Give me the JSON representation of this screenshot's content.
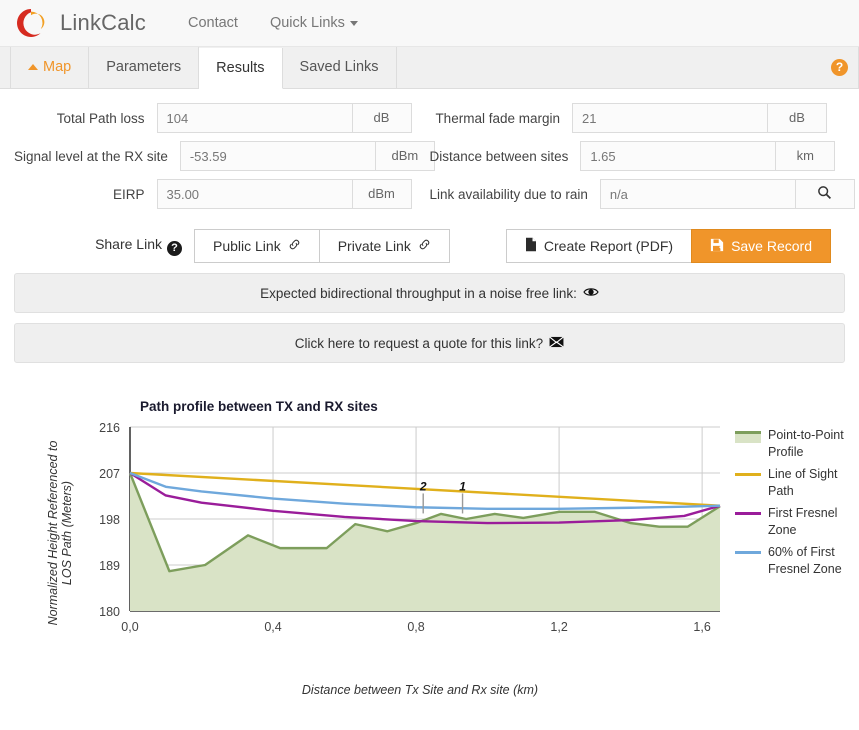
{
  "header": {
    "brand": "LinkCalc",
    "logo_colors": {
      "red": "#d62b20",
      "orange": "#f2a024"
    },
    "nav": [
      {
        "label": "Contact",
        "caret": false
      },
      {
        "label": "Quick Links",
        "caret": true
      }
    ]
  },
  "tabs": {
    "items": [
      {
        "label": "Map",
        "accent": true,
        "icon": "chevron-up-icon",
        "active": false
      },
      {
        "label": "Parameters",
        "accent": false,
        "active": false
      },
      {
        "label": "Results",
        "accent": false,
        "active": true
      },
      {
        "label": "Saved Links",
        "accent": false,
        "active": false
      }
    ],
    "help_icon": "?"
  },
  "results": {
    "rows": [
      {
        "left": {
          "label": "Total Path loss",
          "value": "104",
          "unit": "dB",
          "unit_icon": null
        },
        "right": {
          "label": "Thermal fade margin",
          "value": "21",
          "unit": "dB",
          "unit_icon": null
        }
      },
      {
        "left": {
          "label": "Signal level at the RX site",
          "value": "-53.59",
          "unit": "dBm",
          "unit_icon": null
        },
        "right": {
          "label": "Distance between sites",
          "value": "1.65",
          "unit": "km",
          "unit_icon": null
        }
      },
      {
        "left": {
          "label": "EIRP",
          "value": "35.00",
          "unit": "dBm",
          "unit_icon": null
        },
        "right": {
          "label": "Link availability due to rain",
          "value": "n/a",
          "unit": "",
          "unit_icon": "search-icon"
        }
      }
    ]
  },
  "actions": {
    "share_label": "Share Link",
    "share_help": "?",
    "public_link": "Public Link",
    "private_link": "Private Link",
    "link_icon": "℘",
    "create_report": "Create Report (PDF)",
    "report_icon": "🗋",
    "save_record": "Save Record",
    "save_icon": "💾",
    "primary_color": "#f0952a"
  },
  "notices": [
    {
      "text": "Expected bidirectional throughput in a noise free link:",
      "icon": "eye-icon",
      "glyph": "◉"
    },
    {
      "text": "Click here to request a quote for this link?",
      "icon": "envelope-icon",
      "glyph": "✉"
    }
  ],
  "chart_data": {
    "type": "area",
    "title": "Path profile between TX and RX sites",
    "xlabel": "Distance between Tx Site and Rx site (km)",
    "ylabel": "Normalized Height Referenced to LOS Path (Meters)",
    "xlim": [
      0.0,
      1.65
    ],
    "ylim": [
      180,
      216
    ],
    "xticks": [
      0.0,
      0.4,
      0.8,
      1.2,
      1.6
    ],
    "xticklabels": [
      "0,0",
      "0,4",
      "0,8",
      "1,2",
      "1,6"
    ],
    "yticks": [
      180,
      189,
      198,
      207,
      216
    ],
    "yticklabels": [
      "180",
      "189",
      "198",
      "207",
      "216"
    ],
    "grid": true,
    "legend_position": "right",
    "annotations": [
      {
        "label": "2",
        "x": 0.82,
        "y": 203.0
      },
      {
        "label": "1",
        "x": 0.93,
        "y": 203.0
      }
    ],
    "series": [
      {
        "name": "Point-to-Point Profile",
        "color": "#7d9e5c",
        "fill": "#d9e3c6",
        "type": "area",
        "x": [
          0.0,
          0.11,
          0.21,
          0.33,
          0.42,
          0.55,
          0.63,
          0.72,
          0.8,
          0.87,
          0.94,
          1.02,
          1.1,
          1.2,
          1.3,
          1.4,
          1.48,
          1.56,
          1.65
        ],
        "y": [
          207.0,
          187.8,
          189.0,
          194.8,
          192.3,
          192.3,
          197.0,
          195.6,
          197.2,
          199.0,
          198.0,
          199.0,
          198.2,
          199.4,
          199.4,
          197.2,
          196.5,
          196.5,
          200.5
        ]
      },
      {
        "name": "Line of Sight Path",
        "color": "#e0b01c",
        "type": "line",
        "x": [
          0.0,
          1.65
        ],
        "y": [
          207.0,
          200.6
        ]
      },
      {
        "name": "First Fresnel Zone",
        "color": "#9a1d9a",
        "type": "line",
        "x": [
          0.0,
          0.1,
          0.2,
          0.4,
          0.6,
          0.8,
          1.0,
          1.2,
          1.4,
          1.55,
          1.65
        ],
        "y": [
          207.0,
          202.6,
          201.2,
          199.6,
          198.4,
          197.6,
          197.2,
          197.3,
          197.8,
          198.6,
          200.6
        ]
      },
      {
        "name": "60% of First Fresnel Zone",
        "color": "#6fa8dc",
        "type": "line",
        "x": [
          0.0,
          0.1,
          0.2,
          0.4,
          0.6,
          0.8,
          1.0,
          1.2,
          1.4,
          1.55,
          1.65
        ],
        "y": [
          207.0,
          204.3,
          203.4,
          202.0,
          201.0,
          200.3,
          200.0,
          200.0,
          200.2,
          200.4,
          200.6
        ]
      }
    ]
  }
}
